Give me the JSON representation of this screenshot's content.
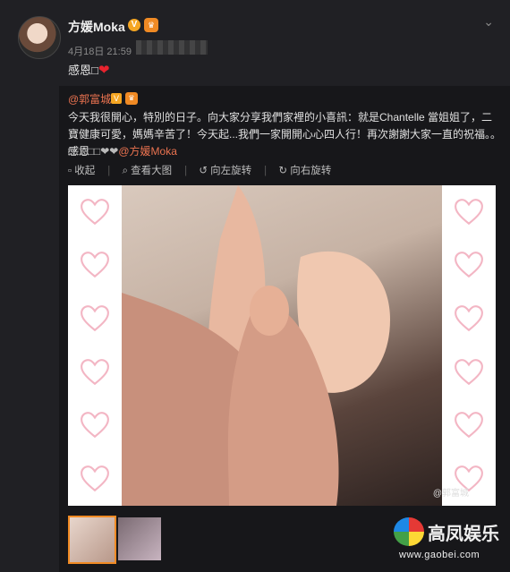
{
  "post": {
    "username": "方媛Moka",
    "timestamp": "4月18日 21:59",
    "text": "感恩",
    "verified_badge": "V"
  },
  "repost": {
    "mention": "@郭富城",
    "body": "今天我很開心，特別的日子。向大家分享我們家裡的小喜訊：就是Chantelle 當姐姐了，二寶健康可愛，媽媽辛苦了！今天起...我們一家開開心心四人行！再次謝謝大家一直的祝福。。感恩",
    "sig_prefix": "□□□□□❤❤",
    "sig_link": "@方媛Moka",
    "toolbar": [
      "收起",
      "查看大图",
      "向左旋转",
      "向右旋转"
    ],
    "watermark": "@郭富城"
  },
  "site": {
    "title": "高凤娱乐",
    "url": "www.gaobei.com"
  },
  "colors": {
    "accent": "#eb7350",
    "heart": "#e8232e"
  }
}
